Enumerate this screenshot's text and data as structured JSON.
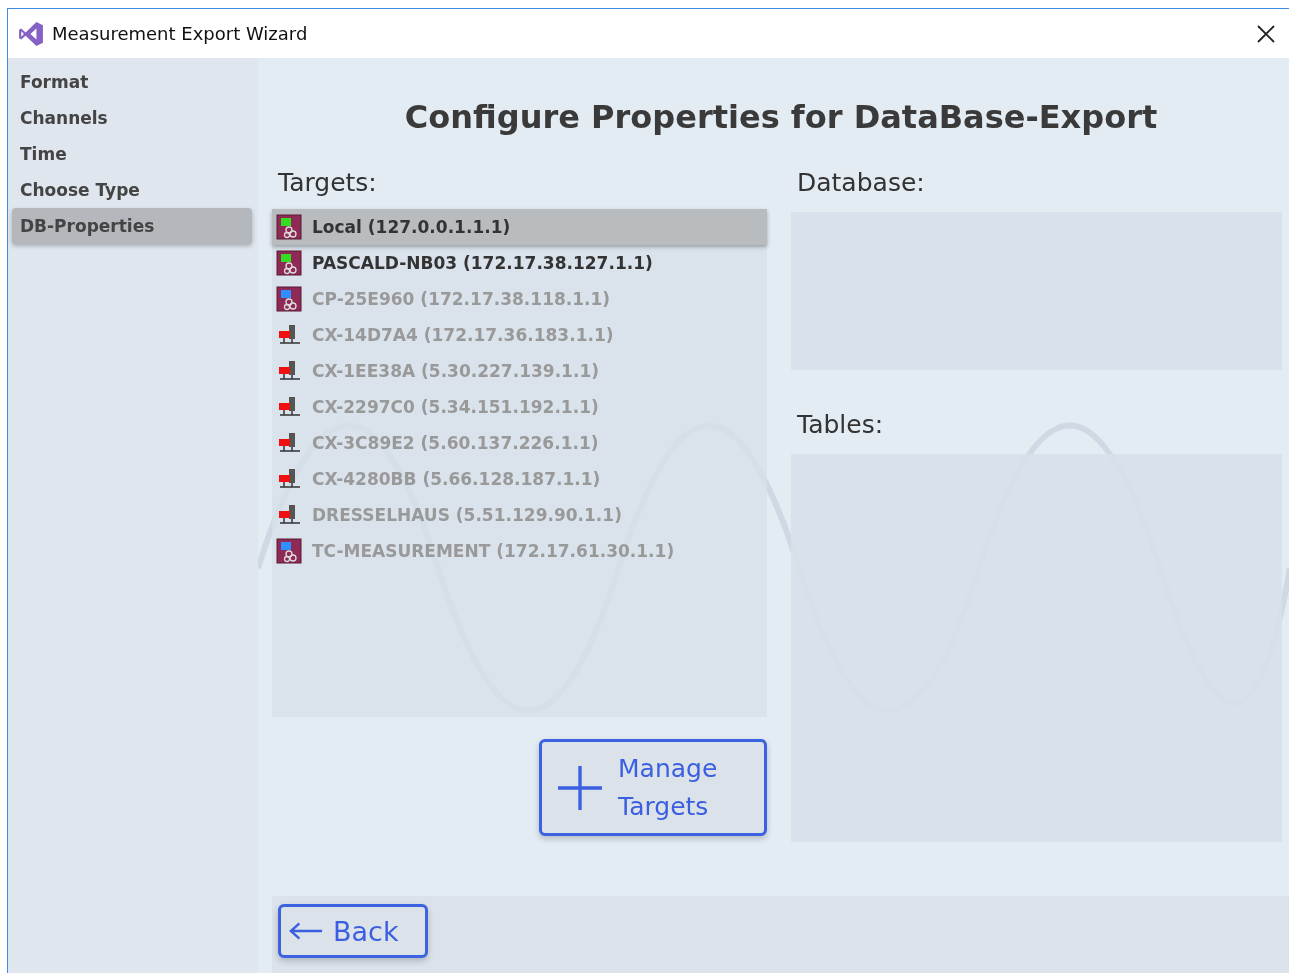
{
  "window": {
    "title": "Measurement Export Wizard"
  },
  "sidebar": {
    "items": [
      {
        "label": "Format",
        "selected": false
      },
      {
        "label": "Channels",
        "selected": false
      },
      {
        "label": "Time",
        "selected": false
      },
      {
        "label": "Choose Type",
        "selected": false
      },
      {
        "label": "DB-Properties",
        "selected": true
      }
    ]
  },
  "heading": "Configure Properties for DataBase-Export",
  "targets": {
    "label": "Targets:",
    "items": [
      {
        "kind": "runtime",
        "color": "#33dd22",
        "label": "Local (127.0.0.1.1.1)",
        "online": true,
        "selected": true
      },
      {
        "kind": "runtime",
        "color": "#33dd22",
        "label": "PASCALD-NB03 (172.17.38.127.1.1)",
        "online": true,
        "selected": false
      },
      {
        "kind": "runtime",
        "color": "#2f8fff",
        "label": "CP-25E960 (172.17.38.118.1.1)",
        "online": false,
        "selected": false
      },
      {
        "kind": "device",
        "color": "#ee1111",
        "label": "CX-14D7A4 (172.17.36.183.1.1)",
        "online": false,
        "selected": false
      },
      {
        "kind": "device",
        "color": "#ee1111",
        "label": "CX-1EE38A (5.30.227.139.1.1)",
        "online": false,
        "selected": false
      },
      {
        "kind": "device",
        "color": "#ee1111",
        "label": "CX-2297C0 (5.34.151.192.1.1)",
        "online": false,
        "selected": false
      },
      {
        "kind": "device",
        "color": "#ee1111",
        "label": "CX-3C89E2 (5.60.137.226.1.1)",
        "online": false,
        "selected": false
      },
      {
        "kind": "device",
        "color": "#ee1111",
        "label": "CX-4280BB (5.66.128.187.1.1)",
        "online": false,
        "selected": false
      },
      {
        "kind": "device",
        "color": "#ee1111",
        "label": "DRESSELHAUS (5.51.129.90.1.1)",
        "online": false,
        "selected": false
      },
      {
        "kind": "runtime",
        "color": "#2f8fff",
        "label": "TC-MEASUREMENT (172.17.61.30.1.1)",
        "online": false,
        "selected": false
      }
    ]
  },
  "database": {
    "label": "Database:"
  },
  "tables": {
    "label": "Tables:"
  },
  "manage_button": {
    "line_1": "Manage",
    "line_2": "Targets"
  },
  "back_button": {
    "label": "Back"
  }
}
